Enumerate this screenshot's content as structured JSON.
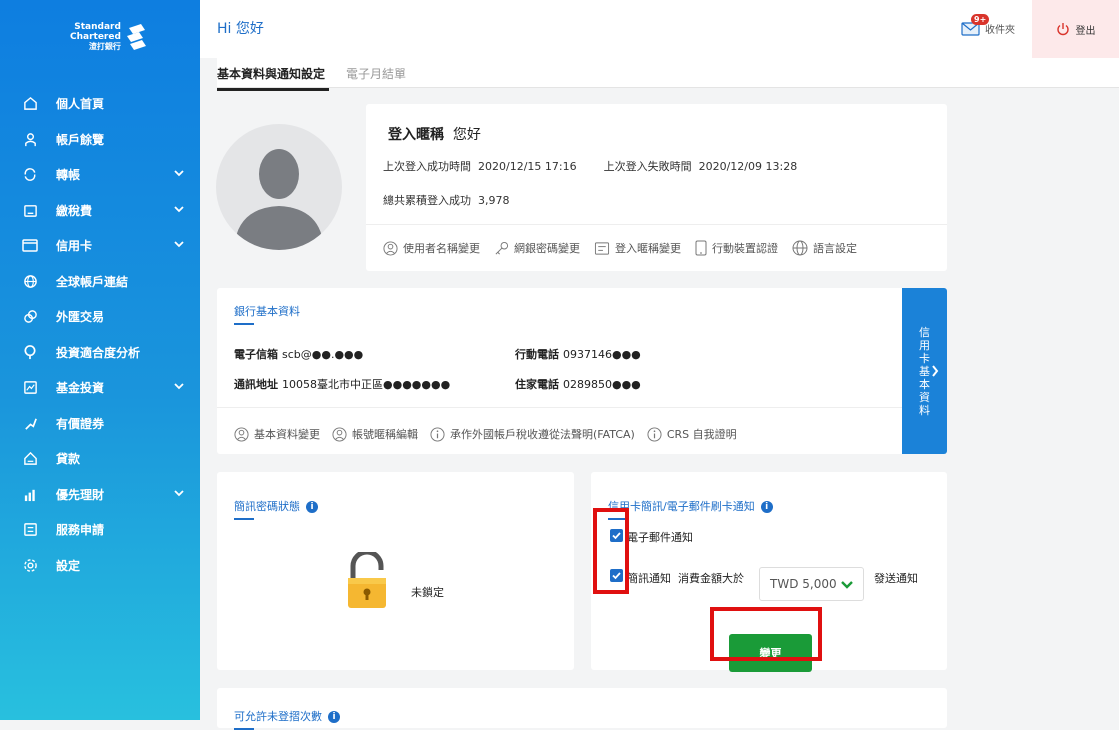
{
  "brand": {
    "line1": "Standard",
    "line2": "Chartered",
    "line3": "渣打銀行"
  },
  "sidebar": {
    "items": [
      {
        "label": "個人首頁",
        "icon": "home-icon",
        "expandable": false
      },
      {
        "label": "帳戶餘覽",
        "icon": "user-icon",
        "expandable": false
      },
      {
        "label": "轉帳",
        "icon": "transfer-icon",
        "expandable": true
      },
      {
        "label": "繳稅費",
        "icon": "bill-icon",
        "expandable": true
      },
      {
        "label": "信用卡",
        "icon": "credit-card-icon",
        "expandable": true
      },
      {
        "label": "全球帳戶連結",
        "icon": "globe-icon",
        "expandable": false
      },
      {
        "label": "外匯交易",
        "icon": "fx-icon",
        "expandable": false
      },
      {
        "label": "投資適合度分析",
        "icon": "analysis-icon",
        "expandable": false
      },
      {
        "label": "基金投資",
        "icon": "fund-icon",
        "expandable": true
      },
      {
        "label": "有價證券",
        "icon": "securities-icon",
        "expandable": false
      },
      {
        "label": "貸款",
        "icon": "loan-icon",
        "expandable": false
      },
      {
        "label": "優先理財",
        "icon": "priority-icon",
        "expandable": true
      },
      {
        "label": "服務申請",
        "icon": "service-icon",
        "expandable": false
      },
      {
        "label": "設定",
        "icon": "gear-icon",
        "expandable": false
      }
    ]
  },
  "header": {
    "greeting": "Hi 您好",
    "inbox_label": "收件夾",
    "inbox_badge": "9+",
    "logout_label": "登出"
  },
  "tabs": [
    {
      "label": "基本資料與通知設定",
      "active": true
    },
    {
      "label": "電子月結單",
      "active": false
    }
  ],
  "profile": {
    "nickname_label": "登入暱稱",
    "nickname_greeting": "您好",
    "last_login_label": "上次登入成功時間",
    "last_login_value": "2020/12/15 17:16",
    "last_fail_label": "上次登入失敗時間",
    "last_fail_value": "2020/12/09 13:28",
    "total_login_label": "總共累積登入成功",
    "total_login_value": "3,978",
    "links": [
      "使用者名稱變更",
      "網銀密碼變更",
      "登入暱稱變更",
      "行動裝置認證",
      "語言設定"
    ]
  },
  "bank_info": {
    "title": "銀行基本資料",
    "email_label": "電子信箱",
    "email_value": "scb@●●.●●●",
    "mobile_label": "行動電話",
    "mobile_value": "0937146●●●",
    "address_label": "通訊地址",
    "address_value": "10058臺北市中正區●●●●●●●",
    "home_phone_label": "住家電話",
    "home_phone_value": "0289850●●●",
    "links": [
      "基本資料變更",
      "帳號暱稱編輯",
      "承作外國帳戶稅收遵從法聲明(FATCA)",
      "CRS 自我證明"
    ],
    "side_tab": [
      "信",
      "用",
      "卡",
      "基",
      "本",
      "資",
      "料"
    ]
  },
  "sms_lock": {
    "title": "簡訊密碼狀態",
    "status": "未鎖定"
  },
  "card_notice": {
    "title": "信用卡簡訊/電子郵件刷卡通知",
    "email_option": "電子郵件通知",
    "sms_option": "簡訊通知",
    "amount_prefix": "消費金額大於",
    "amount_value": "TWD 5,000",
    "amount_suffix": "發送通知",
    "submit_label": "變更"
  },
  "unlogged": {
    "title": "可允許未登摺次數"
  },
  "colors": {
    "brand_blue": "#1e6ec8",
    "accent_green": "#1a9b38",
    "highlight_red": "#e01010",
    "badge_red": "#d9342b"
  }
}
